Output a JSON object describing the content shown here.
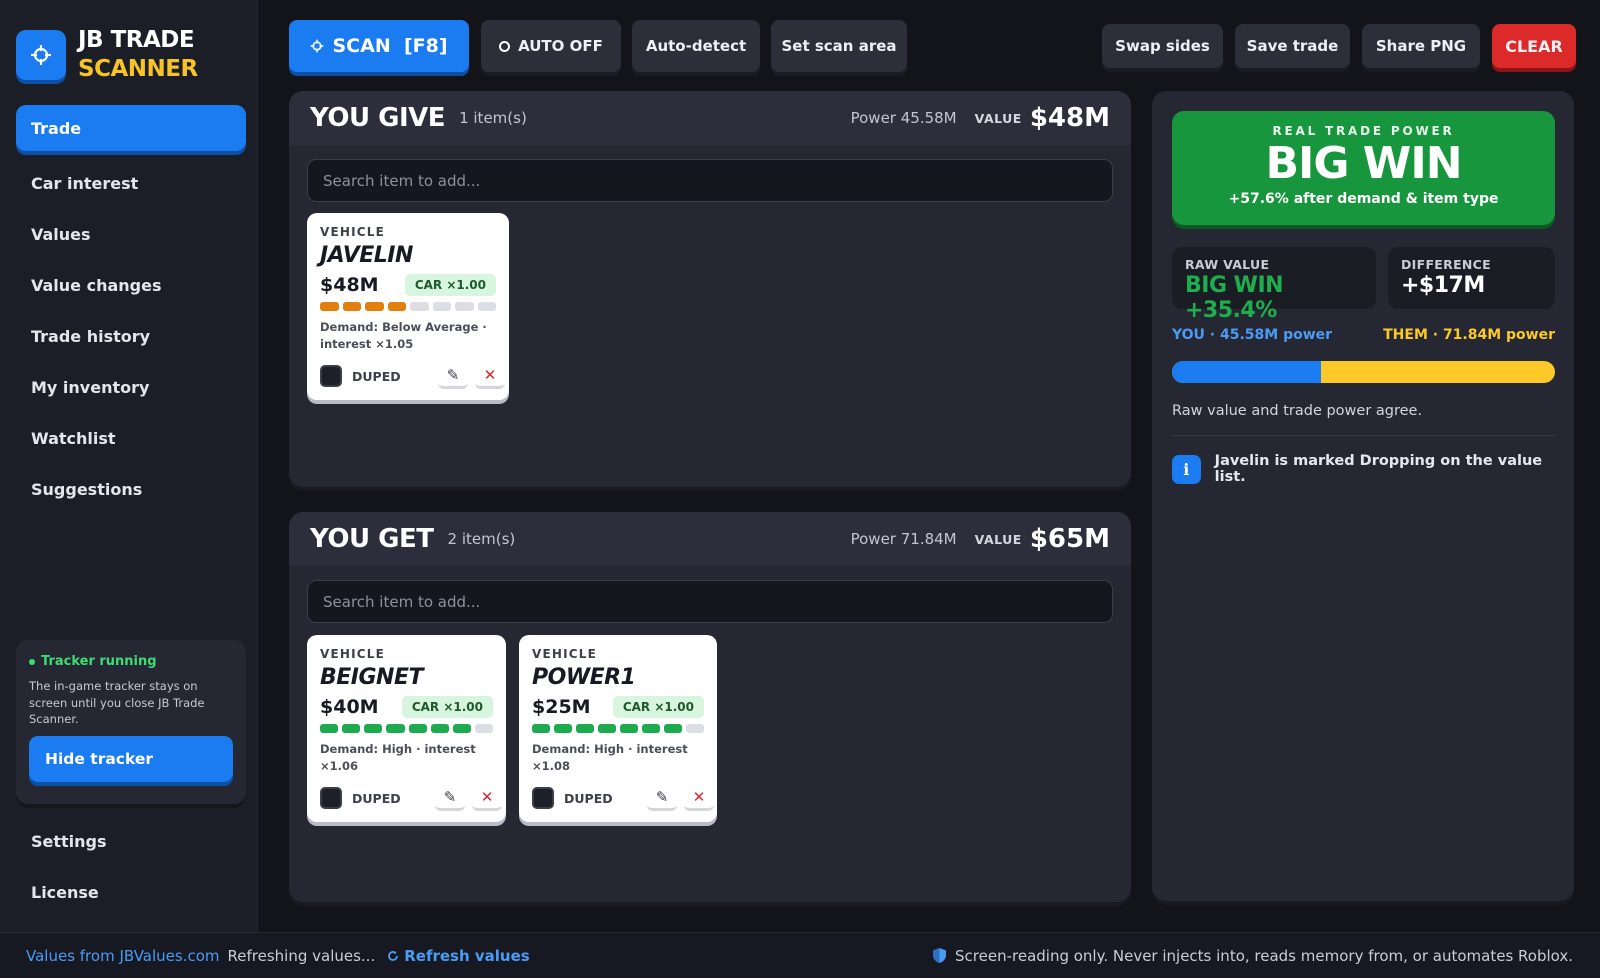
{
  "app": {
    "logo_line1": "JB TRADE",
    "logo_line2": "SCANNER",
    "accent": "#1a7cf0",
    "brand_yellow": "#f7c325"
  },
  "sidebar": {
    "items": [
      {
        "label": "Trade",
        "active": true
      },
      {
        "label": "Car interest"
      },
      {
        "label": "Values"
      },
      {
        "label": "Value changes"
      },
      {
        "label": "Trade history"
      },
      {
        "label": "My inventory"
      },
      {
        "label": "Watchlist"
      },
      {
        "label": "Suggestions"
      }
    ],
    "tracker": {
      "title": "Tracker running",
      "description": "The in-game tracker stays on screen until you close JB Trade Scanner.",
      "button": "Hide tracker"
    },
    "bottom_items": [
      {
        "label": "Settings"
      },
      {
        "label": "License"
      }
    ]
  },
  "toolbar": {
    "scan": "SCAN  [F8]",
    "auto": "AUTO OFF",
    "auto_detect": "Auto-detect",
    "set_scan_area": "Set scan area",
    "swap_sides": "Swap sides",
    "save_trade": "Save trade",
    "share_png": "Share PNG",
    "clear": "CLEAR"
  },
  "give": {
    "title": "YOU GIVE",
    "count": "1 item(s)",
    "power": "Power 45.58M",
    "value_label": "VALUE",
    "value": "$48M",
    "search_placeholder": "Search item to add...",
    "items": [
      {
        "type": "VEHICLE",
        "name": "JAVELIN",
        "price": "$48M",
        "chip": "CAR ×1.00",
        "demand_level": 4,
        "demand_max": 8,
        "demand_color": "orange",
        "demand_text": "Demand: Below Average · interest ×1.05",
        "duped": "DUPED"
      }
    ]
  },
  "get": {
    "title": "YOU GET",
    "count": "2 item(s)",
    "power": "Power 71.84M",
    "value_label": "VALUE",
    "value": "$65M",
    "search_placeholder": "Search item to add...",
    "items": [
      {
        "type": "VEHICLE",
        "name": "BEIGNET",
        "price": "$40M",
        "chip": "CAR ×1.00",
        "demand_level": 7,
        "demand_max": 8,
        "demand_color": "green",
        "demand_text": "Demand: High · interest ×1.06",
        "duped": "DUPED"
      },
      {
        "type": "VEHICLE",
        "name": "POWER1",
        "price": "$25M",
        "chip": "CAR ×1.00",
        "demand_level": 7,
        "demand_max": 8,
        "demand_color": "green",
        "demand_text": "Demand: High · interest ×1.08",
        "duped": "DUPED"
      }
    ]
  },
  "result": {
    "kicker": "REAL TRADE POWER",
    "verdict": "BIG WIN",
    "verdict_sub": "+57.6% after demand & item type",
    "raw_label": "RAW VALUE",
    "raw_value": "BIG WIN +35.4%",
    "diff_label": "DIFFERENCE",
    "diff_value": "+$17M",
    "you_power": "YOU · 45.58M power",
    "them_power": "THEM · 71.84M power",
    "you_share": 0.388,
    "agree_text": "Raw value and trade power agree.",
    "info_text": "Javelin is marked Dropping on the value list.",
    "win_color": "#18963e"
  },
  "footer": {
    "source": "Values from JBValues.com",
    "refreshing": "Refreshing values...",
    "refresh": "Refresh values",
    "disclaimer": "Screen-reading only. Never injects into, reads memory from, or automates Roblox."
  }
}
